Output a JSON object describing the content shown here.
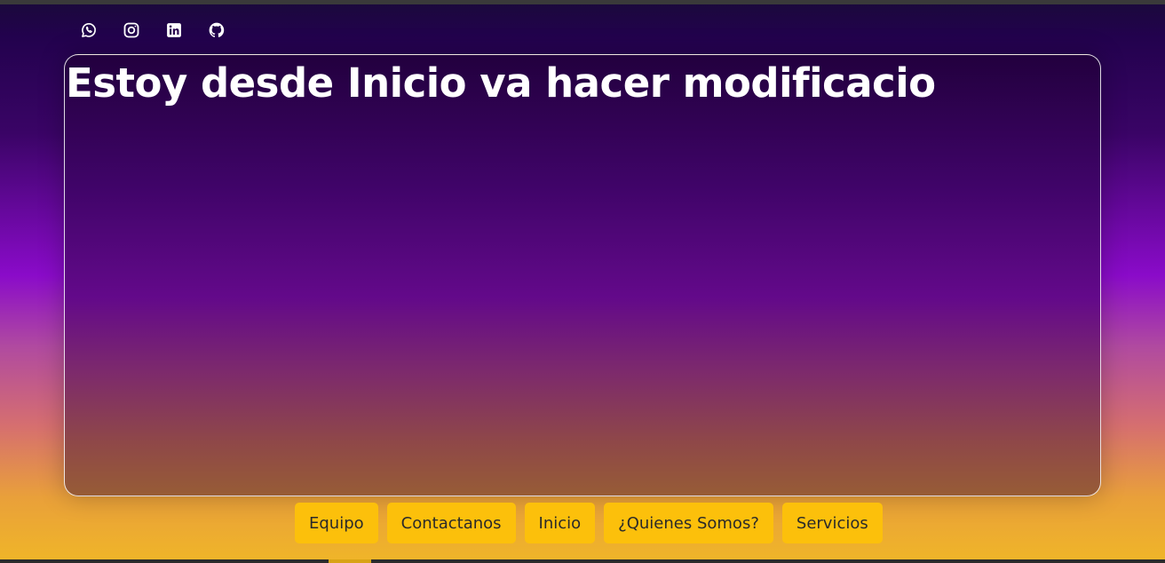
{
  "social": {
    "items": [
      {
        "icon": "whatsapp-icon"
      },
      {
        "icon": "instagram-icon"
      },
      {
        "icon": "linkedin-icon"
      },
      {
        "icon": "github-icon"
      }
    ]
  },
  "hero": {
    "title": "Estoy desde Inicio va hacer modificacio"
  },
  "nav": {
    "items": [
      {
        "label": "Equipo"
      },
      {
        "label": "Contactanos"
      },
      {
        "label": "Inicio"
      },
      {
        "label": "¿Quienes Somos?"
      },
      {
        "label": "Servicios"
      }
    ]
  },
  "colors": {
    "button_bg": "#fcc00b",
    "button_text": "#2a2a2a",
    "title_text": "#ffffff"
  }
}
